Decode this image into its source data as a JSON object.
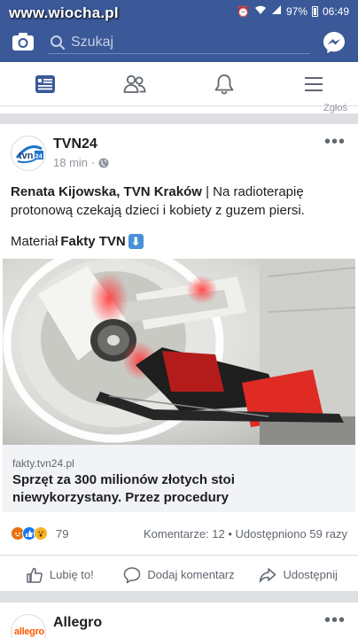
{
  "status_bar": {
    "watermark": "www.wiocha.pl",
    "battery_percent": "97%",
    "time": "06:49"
  },
  "topbar": {
    "search_placeholder": "Szukaj"
  },
  "nav": {
    "tabs": [
      {
        "icon": "news-feed-icon",
        "active": true
      },
      {
        "icon": "friends-icon",
        "active": false
      },
      {
        "icon": "bell-icon",
        "active": false
      },
      {
        "icon": "menu-icon",
        "active": false
      }
    ]
  },
  "prev_stub": {
    "text": "Zgłoś"
  },
  "post": {
    "avatar_text": "tvn24",
    "page_name": "TVN24",
    "time": "18 min",
    "text_bold": "Renata Kijowska, TVN Kraków",
    "text_rest": " | Na radioterapię protonową czekają dzieci i kobiety z guzem piersi.",
    "material_prefix": "Materiał ",
    "material_bold": "Fakty TVN",
    "link_domain": "fakty.tvn24.pl",
    "link_title": "Sprzęt za 300 milionów złotych stoi niewykorzystany. Przez procedury",
    "reaction_count": "79",
    "stats": "Komentarze: 12 • Udostępniono 59 razy",
    "actions": {
      "like": "Lubię to!",
      "comment": "Dodaj komentarz",
      "share": "Udostępnij"
    }
  },
  "post2": {
    "avatar_text": "allegro",
    "page_name": "Allegro"
  },
  "colors": {
    "brand": "#3b5998",
    "active_tab": "#3b5998",
    "icon_gray": "#606770"
  }
}
